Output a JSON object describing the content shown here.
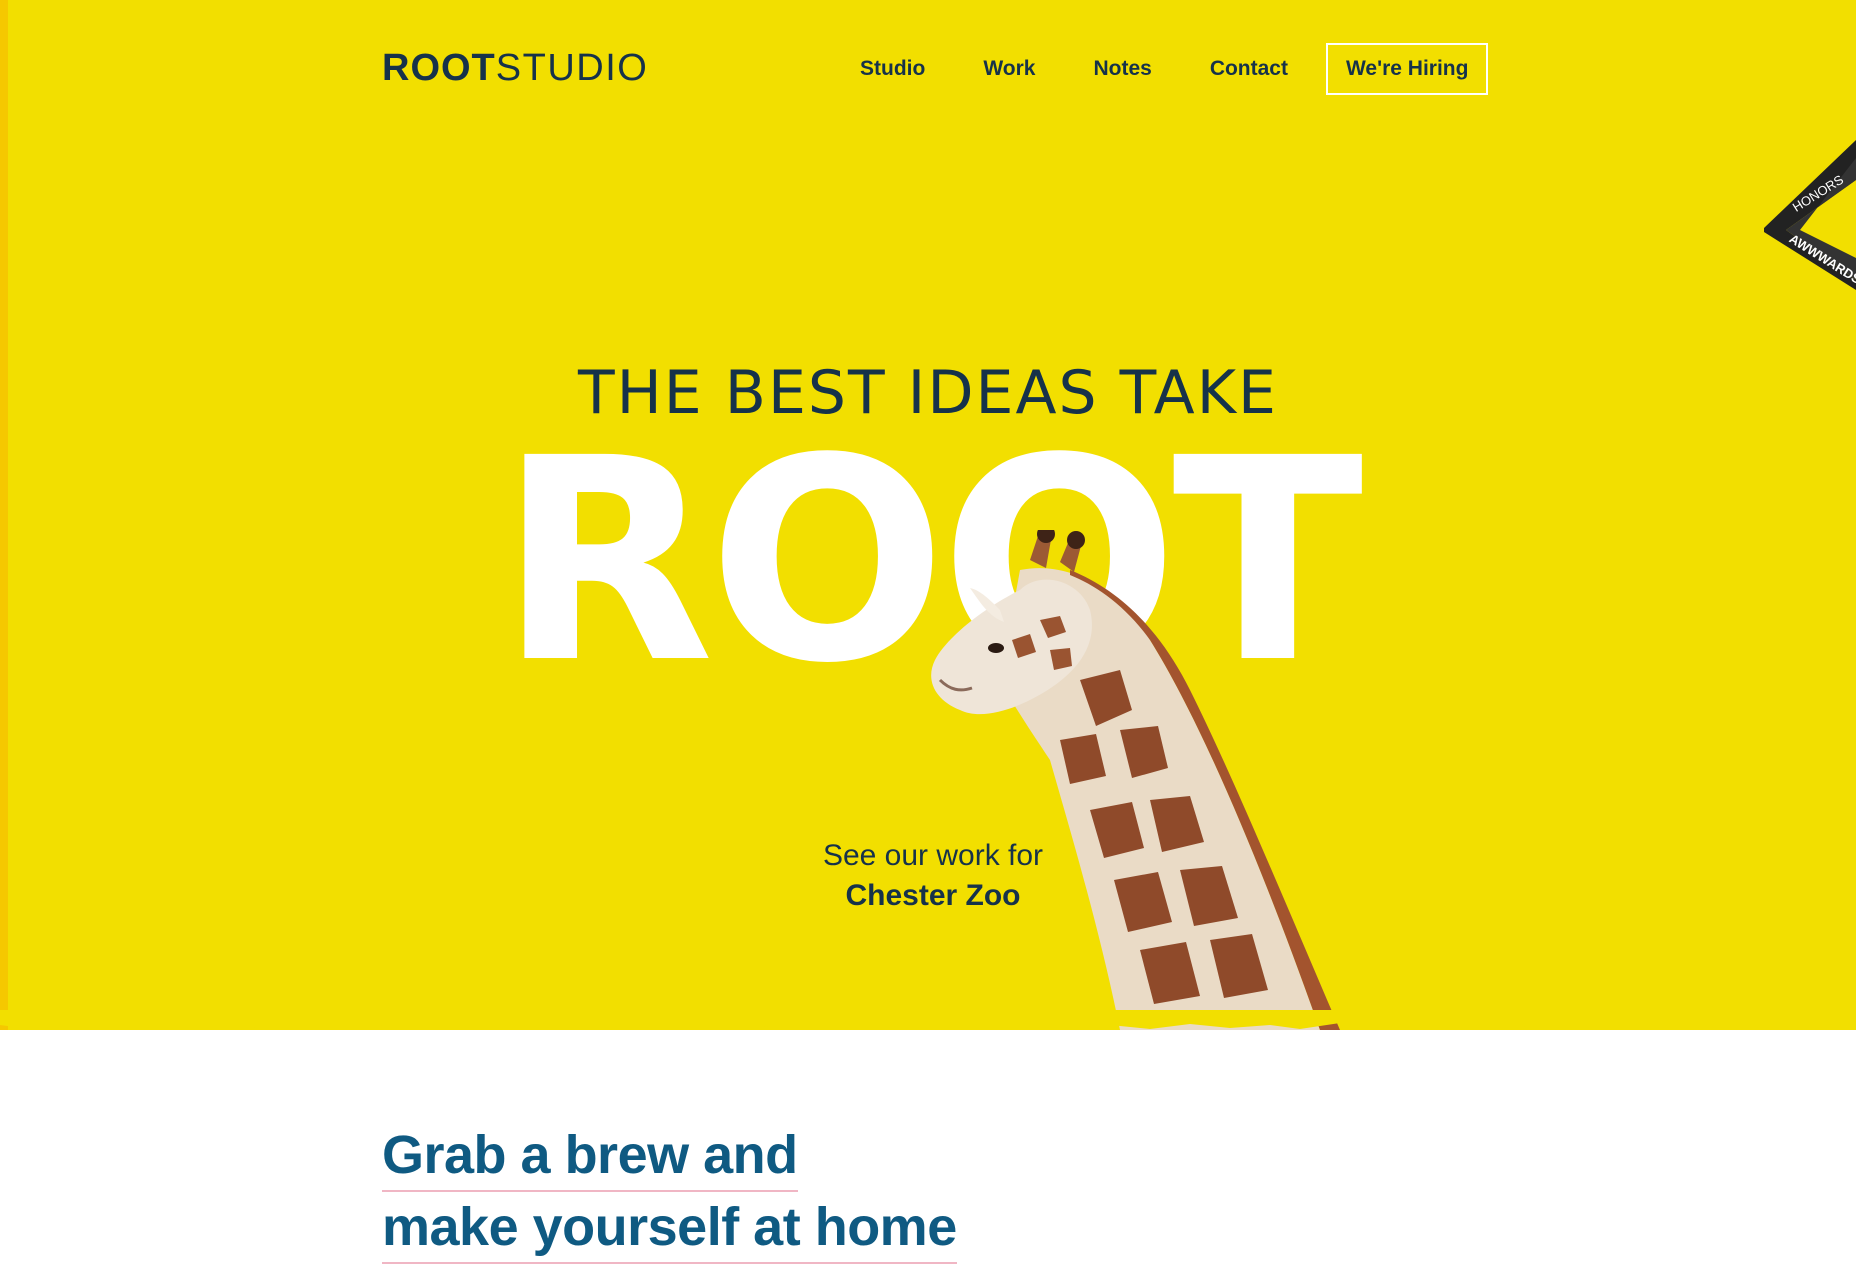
{
  "header": {
    "logo_bold": "ROOT",
    "logo_light": "STUDIO",
    "nav": [
      {
        "label": "Studio"
      },
      {
        "label": "Work"
      },
      {
        "label": "Notes"
      },
      {
        "label": "Contact"
      }
    ],
    "hiring_label": "We're Hiring"
  },
  "awards": {
    "top_text": "HONORS",
    "bottom_text": "AWWWARDS"
  },
  "hero": {
    "tagline": "THE BEST IDEAS TAKE",
    "headline": "ROOT",
    "case_intro": "See our work for",
    "case_client": "Chester Zoo"
  },
  "welcome": {
    "line1": "Grab a brew and",
    "line2": "make yourself at home"
  },
  "colors": {
    "hero_background": "#f2df00",
    "navy": "#16324a",
    "welcome_blue": "#0f5a82",
    "underline_pink": "#f0b6c4",
    "awards_teal": "#30c0b0"
  },
  "icons": {
    "logo": "root-studio-logo",
    "giraffe": "giraffe-image",
    "awards": "awwwards-ribbon-icon"
  }
}
